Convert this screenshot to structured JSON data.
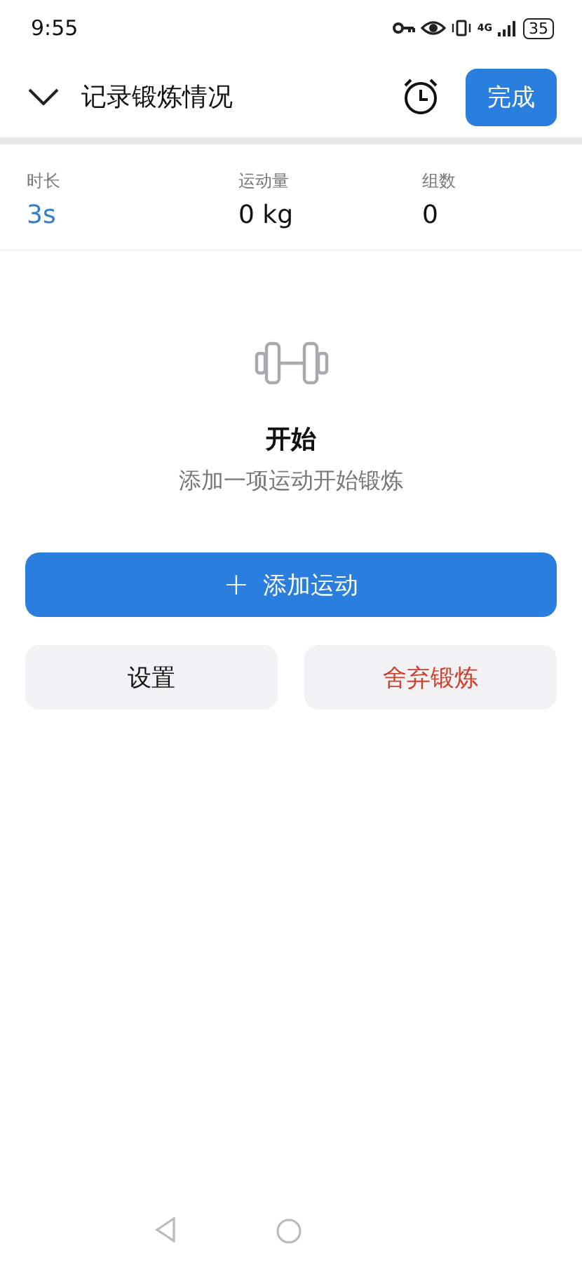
{
  "status_bar": {
    "time": "9:55",
    "network": "4G",
    "battery": "35"
  },
  "header": {
    "title": "记录锻炼情况",
    "done_button": "完成"
  },
  "stats": [
    {
      "label": "时长",
      "value": "3s",
      "accent": true
    },
    {
      "label": "运动量",
      "value": "0 kg",
      "accent": false
    },
    {
      "label": "组数",
      "value": "0",
      "accent": false
    }
  ],
  "empty_state": {
    "title": "开始",
    "subtitle": "添加一项运动开始锻炼"
  },
  "add_button": {
    "icon": "+",
    "label": "添加运动"
  },
  "actions": [
    {
      "label": "设置",
      "kind": "normal"
    },
    {
      "label": "舍弃锻炼",
      "kind": "danger"
    }
  ]
}
